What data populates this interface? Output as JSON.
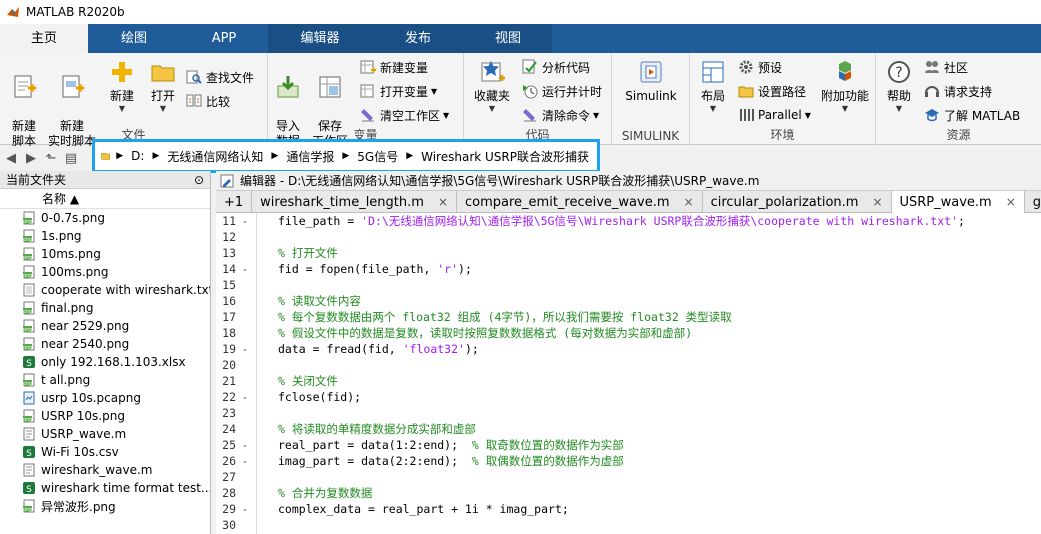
{
  "window": {
    "title": "MATLAB R2020b"
  },
  "tabs": [
    {
      "label": "主页",
      "active": true
    },
    {
      "label": "绘图"
    },
    {
      "label": "APP"
    },
    {
      "label": "编辑器",
      "ctx": true
    },
    {
      "label": "发布",
      "ctx": true
    },
    {
      "label": "视图",
      "ctx": true
    }
  ],
  "ribbon": {
    "file": {
      "label": "文件",
      "new_script": "新建\n脚本",
      "new_live": "新建\n实时脚本",
      "new": "新建",
      "open": "打开",
      "find_files": "查找文件",
      "compare": "比较"
    },
    "variable": {
      "label": "变量",
      "import": "导入\n数据",
      "save_ws": "保存\n工作区",
      "new_var": "新建变量",
      "open_var": "打开变量",
      "clear_ws": "清空工作区"
    },
    "code": {
      "label": "代码",
      "favorites": "收藏夹",
      "analyze": "分析代码",
      "run_time": "运行并计时",
      "clear_cmd": "清除命令"
    },
    "simulink": {
      "label": "SIMULINK",
      "btn": "Simulink"
    },
    "env": {
      "label": "环境",
      "layout": "布局",
      "prefs": "预设",
      "set_path": "设置路径",
      "parallel": "Parallel",
      "addons": "附加功能"
    },
    "resources": {
      "label": "资源",
      "help": "帮助",
      "community": "社区",
      "support": "请求支持",
      "learn": "了解 MATLAB"
    }
  },
  "address": {
    "root": "D:",
    "parts": [
      "无线通信网络认知",
      "通信学报",
      "5G信号",
      "Wireshark USRP联合波形捕获"
    ]
  },
  "files": {
    "header": "当前文件夹",
    "column": "名称 ▲",
    "items": [
      {
        "name": "0-0.7s.png",
        "type": "png"
      },
      {
        "name": "1s.png",
        "type": "png"
      },
      {
        "name": "10ms.png",
        "type": "png"
      },
      {
        "name": "100ms.png",
        "type": "png"
      },
      {
        "name": "cooperate with wireshark.txt",
        "type": "txt"
      },
      {
        "name": "final.png",
        "type": "png"
      },
      {
        "name": "near 2529.png",
        "type": "png"
      },
      {
        "name": "near 2540.png",
        "type": "png"
      },
      {
        "name": "only 192.168.1.103.xlsx",
        "type": "xlsx"
      },
      {
        "name": "t all.png",
        "type": "png"
      },
      {
        "name": "usrp 10s.pcapng",
        "type": "pcap"
      },
      {
        "name": "USRP 10s.png",
        "type": "png"
      },
      {
        "name": "USRP_wave.m",
        "type": "m"
      },
      {
        "name": "Wi-Fi 10s.csv",
        "type": "csv"
      },
      {
        "name": "wireshark_wave.m",
        "type": "m"
      },
      {
        "name": "wireshark time format test....",
        "type": "xlsx"
      },
      {
        "name": "异常波形.png",
        "type": "png"
      }
    ]
  },
  "editor": {
    "title": "编辑器 - D:\\无线通信网络认知\\通信学报\\5G信号\\Wireshark USRP联合波形捕获\\USRP_wave.m",
    "tabs": [
      {
        "label": "+1",
        "close": false
      },
      {
        "label": "wireshark_time_length.m",
        "close": true
      },
      {
        "label": "compare_emit_receive_wave.m",
        "close": true
      },
      {
        "label": "circular_polarization.m",
        "close": true
      },
      {
        "label": "USRP_wave.m",
        "close": true,
        "active": true
      },
      {
        "label": "getExte",
        "close": false
      }
    ],
    "lines": [
      {
        "n": "11",
        "d": "-",
        "parts": [
          {
            "t": "file_path = ",
            "c": "txt"
          },
          {
            "t": "'D:\\无线通信网络认知\\通信学报\\5G信号\\Wireshark USRP联合波形捕获\\cooperate with wireshark.txt'",
            "c": "str"
          },
          {
            "t": ";",
            "c": "txt"
          }
        ]
      },
      {
        "n": "12",
        "d": "",
        "parts": []
      },
      {
        "n": "13",
        "d": "",
        "parts": [
          {
            "t": "% 打开文件",
            "c": "cmt"
          }
        ]
      },
      {
        "n": "14",
        "d": "-",
        "parts": [
          {
            "t": "fid = fopen(file_path, ",
            "c": "txt"
          },
          {
            "t": "'r'",
            "c": "str"
          },
          {
            "t": ");",
            "c": "txt"
          }
        ]
      },
      {
        "n": "15",
        "d": "",
        "parts": []
      },
      {
        "n": "16",
        "d": "",
        "parts": [
          {
            "t": "% 读取文件内容",
            "c": "cmt"
          }
        ]
      },
      {
        "n": "17",
        "d": "",
        "parts": [
          {
            "t": "% 每个复数数据由两个 float32 组成 (4字节)，所以我们需要按 float32 类型读取",
            "c": "cmt"
          }
        ]
      },
      {
        "n": "18",
        "d": "",
        "parts": [
          {
            "t": "% 假设文件中的数据是复数，读取时按照复数数据格式 (每对数据为实部和虚部)",
            "c": "cmt"
          }
        ]
      },
      {
        "n": "19",
        "d": "-",
        "parts": [
          {
            "t": "data = fread(fid, ",
            "c": "txt"
          },
          {
            "t": "'float32'",
            "c": "str"
          },
          {
            "t": ");",
            "c": "txt"
          }
        ]
      },
      {
        "n": "20",
        "d": "",
        "parts": []
      },
      {
        "n": "21",
        "d": "",
        "parts": [
          {
            "t": "% 关闭文件",
            "c": "cmt"
          }
        ]
      },
      {
        "n": "22",
        "d": "-",
        "parts": [
          {
            "t": "fclose(fid);",
            "c": "txt"
          }
        ]
      },
      {
        "n": "23",
        "d": "",
        "parts": []
      },
      {
        "n": "24",
        "d": "",
        "parts": [
          {
            "t": "% 将读取的单精度数据分成实部和虚部",
            "c": "cmt"
          }
        ]
      },
      {
        "n": "25",
        "d": "-",
        "parts": [
          {
            "t": "real_part = data(1:2:end);  ",
            "c": "txt"
          },
          {
            "t": "% 取奇数位置的数据作为实部",
            "c": "cmt"
          }
        ]
      },
      {
        "n": "26",
        "d": "-",
        "parts": [
          {
            "t": "imag_part = data(2:2:end);  ",
            "c": "txt"
          },
          {
            "t": "% 取偶数位置的数据作为虚部",
            "c": "cmt"
          }
        ]
      },
      {
        "n": "27",
        "d": "",
        "parts": []
      },
      {
        "n": "28",
        "d": "",
        "parts": [
          {
            "t": "% 合并为复数数据",
            "c": "cmt"
          }
        ]
      },
      {
        "n": "29",
        "d": "-",
        "parts": [
          {
            "t": "complex_data = real_part + 1i * imag_part;",
            "c": "txt"
          }
        ]
      },
      {
        "n": "30",
        "d": "",
        "parts": []
      }
    ]
  }
}
